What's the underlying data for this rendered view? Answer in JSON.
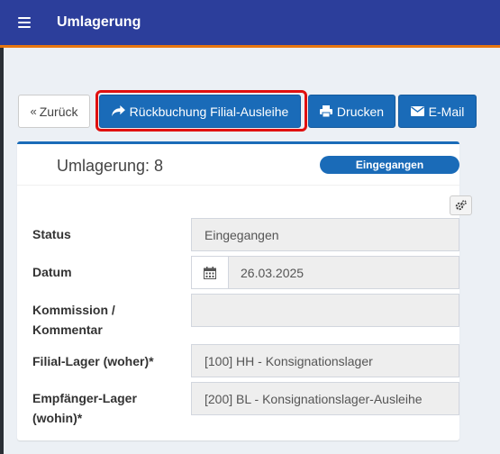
{
  "header": {
    "title": "Umlagerung",
    "menu_icon": "hamburger-icon"
  },
  "toolbar": {
    "back_label": "Zurück",
    "back_icon": "double-chevron-left-icon",
    "rueckbuchung_label": "Rückbuchung Filial-Ausleihe",
    "rueckbuchung_icon": "share-arrow-icon",
    "print_label": "Drucken",
    "print_icon": "printer-icon",
    "email_label": "E-Mail",
    "email_icon": "envelope-icon"
  },
  "record": {
    "title": "Umlagerung: 8",
    "status_badge": "Eingegangen",
    "settings_icon": "gears-icon"
  },
  "form": {
    "status_label": "Status",
    "status_value": "Eingegangen",
    "datum_label": "Datum",
    "datum_value": "26.03.2025",
    "kommission_label_line1": "Kommission /",
    "kommission_label_line2": "Kommentar",
    "kommission_value": "",
    "filial_lager_label": "Filial-Lager (woher)*",
    "filial_lager_value": "[100] HH - Konsignationslager",
    "empfaenger_label_line1": "Empfänger-Lager",
    "empfaenger_label_line2": "(wohin)*",
    "empfaenger_value": "[200] BL - Konsignationslager-Ausleihe"
  },
  "colors": {
    "header_bg": "#2c3e9b",
    "header_accent": "#e8760f",
    "primary": "#1a6bb8",
    "highlight": "#e01010"
  }
}
